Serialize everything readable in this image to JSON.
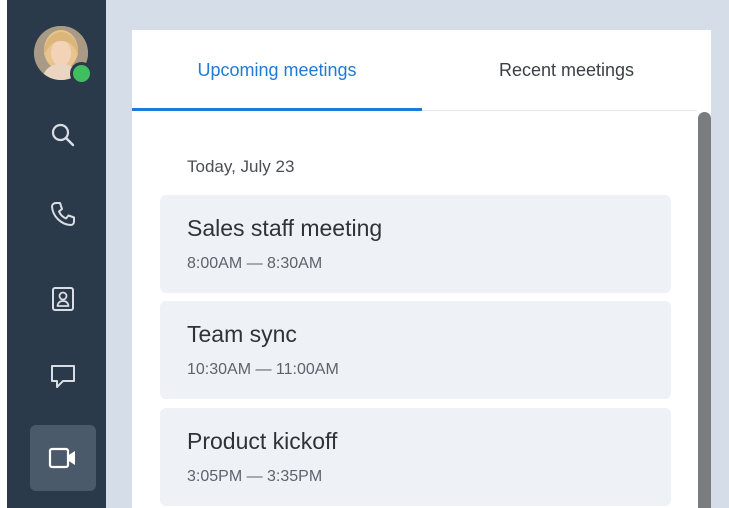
{
  "sidebar": {
    "user": {
      "presence_color": "#3fbf5f"
    },
    "items": [
      {
        "icon": "search-icon"
      },
      {
        "icon": "phone-icon"
      },
      {
        "icon": "contacts-icon"
      },
      {
        "icon": "chat-icon"
      },
      {
        "icon": "video-icon",
        "active": true
      }
    ]
  },
  "tabs": {
    "upcoming": "Upcoming meetings",
    "recent": "Recent meetings",
    "active": "upcoming"
  },
  "schedule": {
    "date": "Today, July 23",
    "meetings": [
      {
        "title": "Sales staff meeting",
        "time": "8:00AM — 8:30AM"
      },
      {
        "title": "Team sync",
        "time": "10:30AM — 11:00AM"
      },
      {
        "title": "Product kickoff",
        "time": "3:05PM — 3:35PM"
      }
    ]
  },
  "colors": {
    "accent": "#1f7bd6",
    "sidebar": "#2b3a4a",
    "background": "#d5dde8"
  }
}
